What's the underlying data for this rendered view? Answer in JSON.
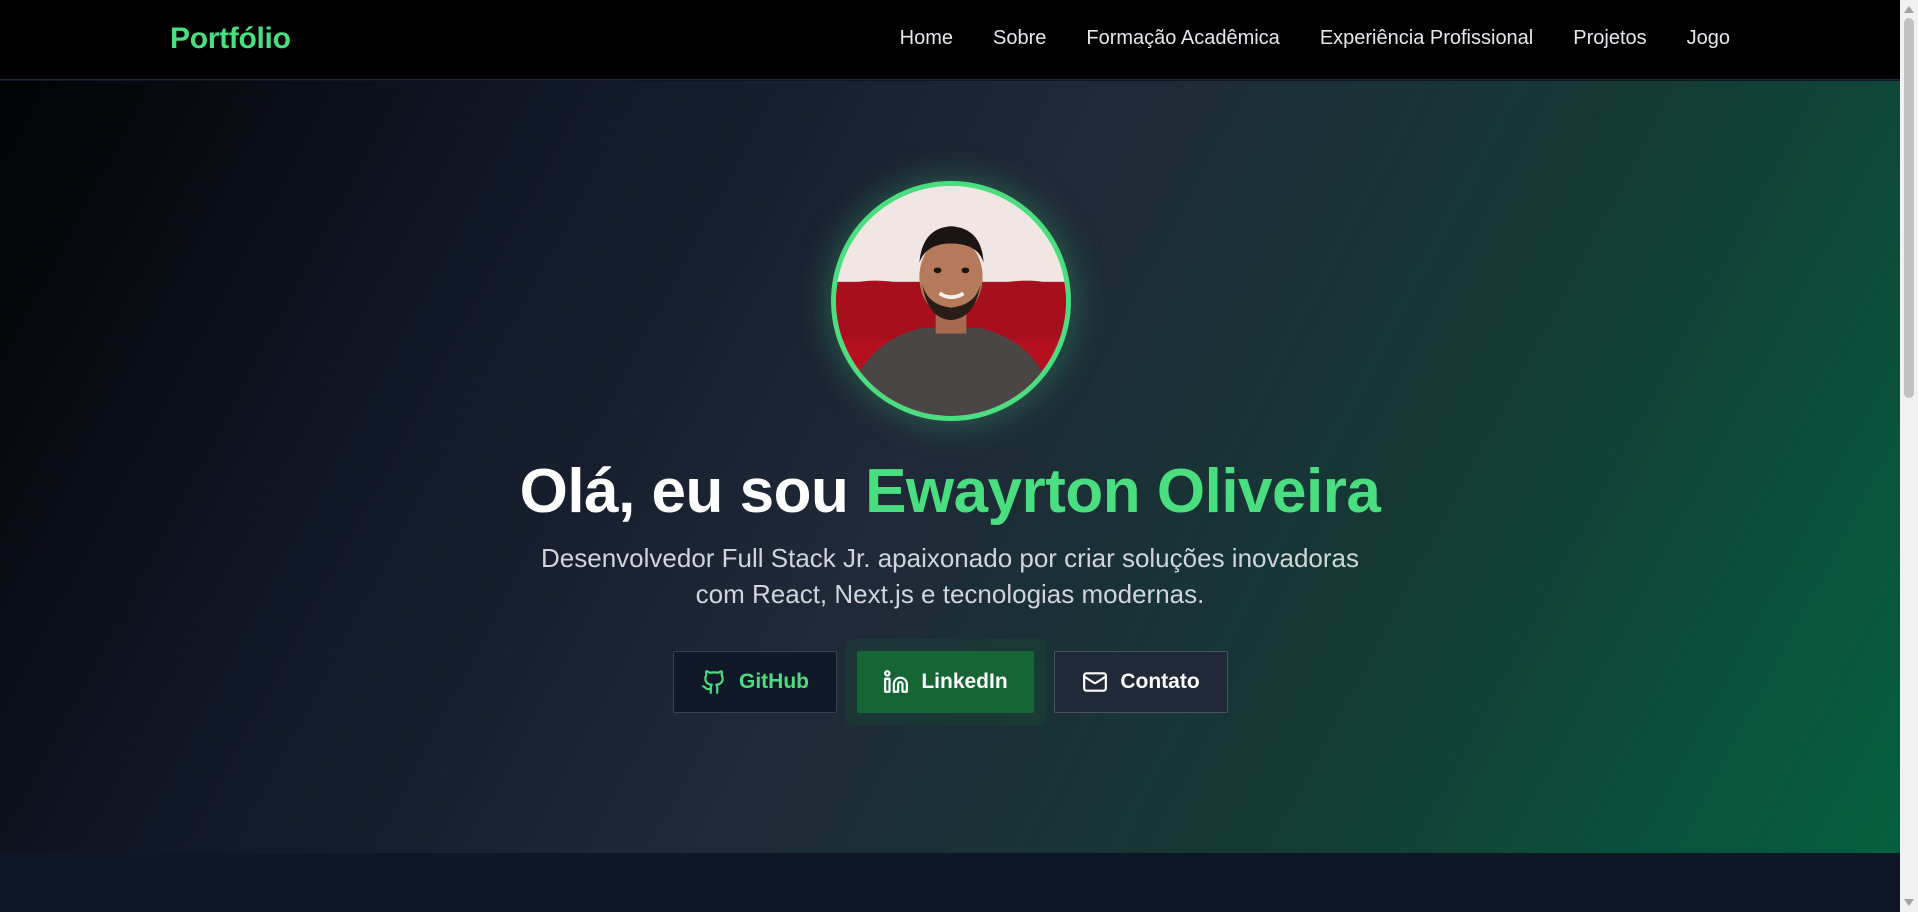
{
  "nav": {
    "brand": "Portfólio",
    "items": [
      {
        "label": "Home"
      },
      {
        "label": "Sobre"
      },
      {
        "label": "Formação Acadêmica"
      },
      {
        "label": "Experiência Profissional"
      },
      {
        "label": "Projetos"
      },
      {
        "label": "Jogo"
      }
    ]
  },
  "hero": {
    "greeting": "Olá, eu sou ",
    "name": "Ewayrton Oliveira",
    "subtitle_line1": "Desenvolvedor Full Stack Jr. apaixonado por criar soluções inovadoras",
    "subtitle_line2": "com React, Next.js e tecnologias modernas.",
    "buttons": {
      "github": {
        "label": "GitHub",
        "icon": "github-icon"
      },
      "linkedin": {
        "label": "LinkedIn",
        "icon": "linkedin-icon"
      },
      "contact": {
        "label": "Contato",
        "icon": "mail-icon"
      }
    }
  },
  "colors": {
    "accent": "#4ade80",
    "nav_background": "#000000",
    "linkedin_button": "#166534",
    "hero_gradient_end": "#05603f"
  }
}
